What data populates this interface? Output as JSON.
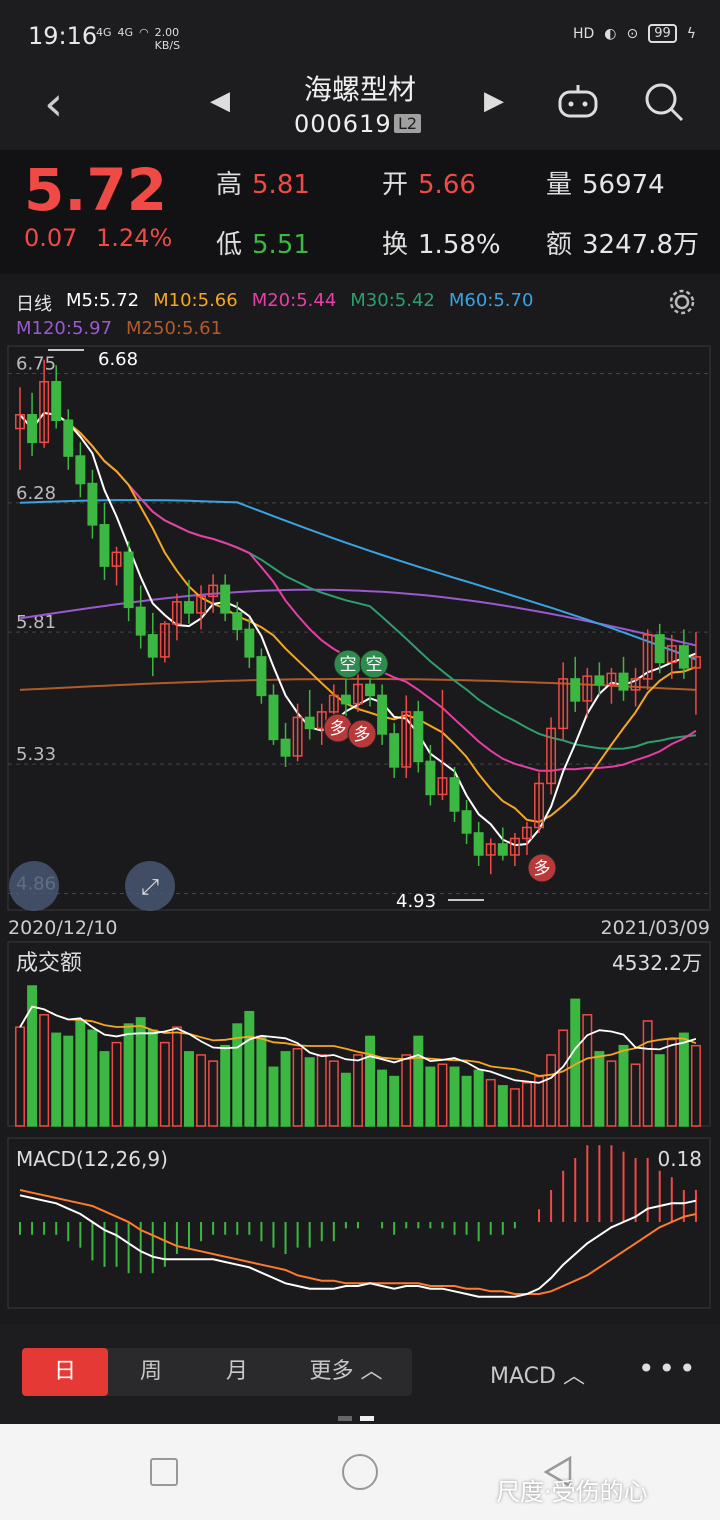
{
  "status": {
    "time": "19:16",
    "net1": "4G",
    "net2": "4G",
    "speed": "2.00",
    "speed_unit": "KB/S",
    "battery": "99"
  },
  "nav": {
    "title": "海螺型材",
    "code": "000619",
    "badge": "L2"
  },
  "quote": {
    "price": "5.72",
    "change": "0.07",
    "change_pct": "1.24%",
    "high_label": "高",
    "high": "5.81",
    "low_label": "低",
    "low": "5.51",
    "open_label": "开",
    "open": "5.66",
    "turnover_label": "换",
    "turnover": "1.58%",
    "volume_label": "量",
    "volume": "56974",
    "amount_label": "额",
    "amount": "3247.8万"
  },
  "ma": {
    "period": "日线",
    "m5": "M5:5.72",
    "m10": "M10:5.66",
    "m20": "M20:5.44",
    "m30": "M30:5.42",
    "m60": "M60:5.70",
    "m120": "M120:5.97",
    "m250": "M250:5.61"
  },
  "colors": {
    "m5": "#ffffff",
    "m10": "#f5a623",
    "m20": "#e83ea5",
    "m30": "#2e9e6e",
    "m60": "#3aa3e3",
    "m120": "#9b59d0",
    "m250": "#b35a2a",
    "up": "#ef4a45",
    "down": "#3cb842"
  },
  "kline": {
    "y_ticks": [
      "6.75",
      "6.28",
      "5.81",
      "5.33",
      "4.86"
    ],
    "high_mark": "6.68",
    "low_mark": "4.93",
    "date_start": "2020/12/10",
    "date_end": "2021/03/09",
    "signal_kong": "空",
    "signal_duo": "多"
  },
  "volume": {
    "title": "成交额",
    "max": "4532.2万"
  },
  "macd": {
    "title": "MACD(12,26,9)",
    "max": "0.18"
  },
  "tabs": {
    "day": "日",
    "week": "周",
    "month": "月",
    "more": "更多",
    "indicator": "MACD"
  },
  "watermark": "尺度·受伤的心",
  "chart_data": {
    "type": "candlestick",
    "candles": [
      [
        6.55,
        6.7,
        6.4,
        6.6
      ],
      [
        6.6,
        6.68,
        6.45,
        6.5
      ],
      [
        6.5,
        6.8,
        6.48,
        6.72
      ],
      [
        6.72,
        6.78,
        6.55,
        6.58
      ],
      [
        6.58,
        6.62,
        6.4,
        6.45
      ],
      [
        6.45,
        6.5,
        6.3,
        6.35
      ],
      [
        6.35,
        6.4,
        6.15,
        6.2
      ],
      [
        6.2,
        6.28,
        6.0,
        6.05
      ],
      [
        6.05,
        6.12,
        5.98,
        6.1
      ],
      [
        6.1,
        6.14,
        5.85,
        5.9
      ],
      [
        5.9,
        5.98,
        5.75,
        5.8
      ],
      [
        5.8,
        5.88,
        5.65,
        5.72
      ],
      [
        5.72,
        5.85,
        5.7,
        5.84
      ],
      [
        5.84,
        5.95,
        5.78,
        5.92
      ],
      [
        5.92,
        6.0,
        5.84,
        5.88
      ],
      [
        5.88,
        5.98,
        5.82,
        5.94
      ],
      [
        5.94,
        6.02,
        5.88,
        5.98
      ],
      [
        5.98,
        6.02,
        5.85,
        5.88
      ],
      [
        5.88,
        5.92,
        5.78,
        5.82
      ],
      [
        5.82,
        5.86,
        5.68,
        5.72
      ],
      [
        5.72,
        5.75,
        5.55,
        5.58
      ],
      [
        5.58,
        5.62,
        5.4,
        5.42
      ],
      [
        5.42,
        5.48,
        5.32,
        5.36
      ],
      [
        5.36,
        5.55,
        5.34,
        5.5
      ],
      [
        5.5,
        5.6,
        5.42,
        5.46
      ],
      [
        5.46,
        5.55,
        5.4,
        5.52
      ],
      [
        5.52,
        5.62,
        5.48,
        5.58
      ],
      [
        5.58,
        5.65,
        5.5,
        5.55
      ],
      [
        5.55,
        5.66,
        5.52,
        5.62
      ],
      [
        5.62,
        5.68,
        5.54,
        5.58
      ],
      [
        5.58,
        5.62,
        5.4,
        5.44
      ],
      [
        5.44,
        5.48,
        5.28,
        5.32
      ],
      [
        5.32,
        5.58,
        5.28,
        5.52
      ],
      [
        5.52,
        5.56,
        5.3,
        5.34
      ],
      [
        5.34,
        5.4,
        5.18,
        5.22
      ],
      [
        5.22,
        5.6,
        5.2,
        5.28
      ],
      [
        5.28,
        5.32,
        5.12,
        5.16
      ],
      [
        5.16,
        5.2,
        5.04,
        5.08
      ],
      [
        5.08,
        5.12,
        4.96,
        5.0
      ],
      [
        5.0,
        5.06,
        4.93,
        5.04
      ],
      [
        5.04,
        5.1,
        4.98,
        5.0
      ],
      [
        5.0,
        5.08,
        4.96,
        5.06
      ],
      [
        5.06,
        5.12,
        5.0,
        5.1
      ],
      [
        5.1,
        5.3,
        5.08,
        5.26
      ],
      [
        5.26,
        5.5,
        5.22,
        5.46
      ],
      [
        5.46,
        5.7,
        5.42,
        5.64
      ],
      [
        5.64,
        5.72,
        5.52,
        5.56
      ],
      [
        5.56,
        5.68,
        5.5,
        5.65
      ],
      [
        5.65,
        5.7,
        5.58,
        5.62
      ],
      [
        5.62,
        5.68,
        5.55,
        5.66
      ],
      [
        5.66,
        5.72,
        5.56,
        5.6
      ],
      [
        5.6,
        5.68,
        5.54,
        5.64
      ],
      [
        5.64,
        5.82,
        5.6,
        5.8
      ],
      [
        5.8,
        5.84,
        5.66,
        5.7
      ],
      [
        5.7,
        5.8,
        5.64,
        5.76
      ],
      [
        5.76,
        5.82,
        5.64,
        5.68
      ],
      [
        5.68,
        5.81,
        5.51,
        5.72
      ]
    ],
    "y_range": [
      4.8,
      6.85
    ],
    "amount": [
      3200,
      4532,
      3600,
      3000,
      2900,
      3400,
      3100,
      2400,
      2700,
      3300,
      3500,
      3100,
      2700,
      3200,
      2400,
      2300,
      2100,
      2600,
      3300,
      3700,
      2900,
      1900,
      2400,
      2500,
      2200,
      2300,
      2100,
      1700,
      2300,
      2900,
      1800,
      1600,
      2300,
      2900,
      1900,
      2000,
      1900,
      1600,
      1800,
      1500,
      1300,
      1200,
      1400,
      1600,
      2300,
      3100,
      4100,
      3600,
      2400,
      2100,
      2600,
      2000,
      3400,
      2300,
      2800,
      3000,
      2600
    ],
    "macd": {
      "dif": [
        0.1,
        0.09,
        0.08,
        0.07,
        0.05,
        0.03,
        0.0,
        -0.03,
        -0.05,
        -0.08,
        -0.11,
        -0.13,
        -0.14,
        -0.14,
        -0.14,
        -0.14,
        -0.14,
        -0.15,
        -0.16,
        -0.17,
        -0.19,
        -0.21,
        -0.23,
        -0.24,
        -0.25,
        -0.25,
        -0.25,
        -0.24,
        -0.24,
        -0.23,
        -0.24,
        -0.25,
        -0.24,
        -0.24,
        -0.25,
        -0.25,
        -0.26,
        -0.27,
        -0.28,
        -0.28,
        -0.28,
        -0.28,
        -0.27,
        -0.25,
        -0.21,
        -0.16,
        -0.12,
        -0.08,
        -0.05,
        -0.02,
        0.0,
        0.02,
        0.05,
        0.06,
        0.07,
        0.07,
        0.08
      ],
      "dea": [
        0.12,
        0.11,
        0.1,
        0.09,
        0.08,
        0.07,
        0.06,
        0.04,
        0.02,
        0.0,
        -0.03,
        -0.05,
        -0.07,
        -0.09,
        -0.1,
        -0.11,
        -0.12,
        -0.13,
        -0.14,
        -0.15,
        -0.16,
        -0.17,
        -0.18,
        -0.2,
        -0.21,
        -0.22,
        -0.22,
        -0.23,
        -0.23,
        -0.23,
        -0.23,
        -0.23,
        -0.23,
        -0.23,
        -0.24,
        -0.24,
        -0.24,
        -0.25,
        -0.25,
        -0.26,
        -0.26,
        -0.27,
        -0.27,
        -0.27,
        -0.26,
        -0.24,
        -0.22,
        -0.2,
        -0.17,
        -0.14,
        -0.11,
        -0.08,
        -0.05,
        -0.02,
        0.0,
        0.02,
        0.03
      ],
      "range": [
        -0.3,
        0.18
      ]
    }
  }
}
